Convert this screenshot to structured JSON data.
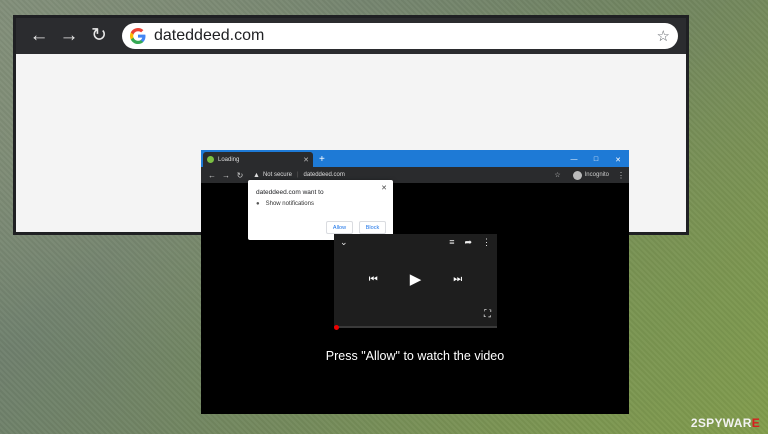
{
  "big_browser": {
    "url": "dateddeed.com"
  },
  "small_browser": {
    "tab_title": "Loading",
    "security_label": "Not secure",
    "url": "dateddeed.com",
    "profile_label": "Incognito",
    "colors": {
      "tabbar": "#1e7ad6",
      "background": "#000000"
    }
  },
  "notification": {
    "title": "dateddeed.com want to",
    "permission": "Show notifications",
    "allow_label": "Allow",
    "block_label": "Block"
  },
  "video": {
    "message": "Press \"Allow\" to watch the video",
    "progress": 0
  },
  "watermark": {
    "prefix": "2SPYWAR",
    "suffix": "E"
  }
}
